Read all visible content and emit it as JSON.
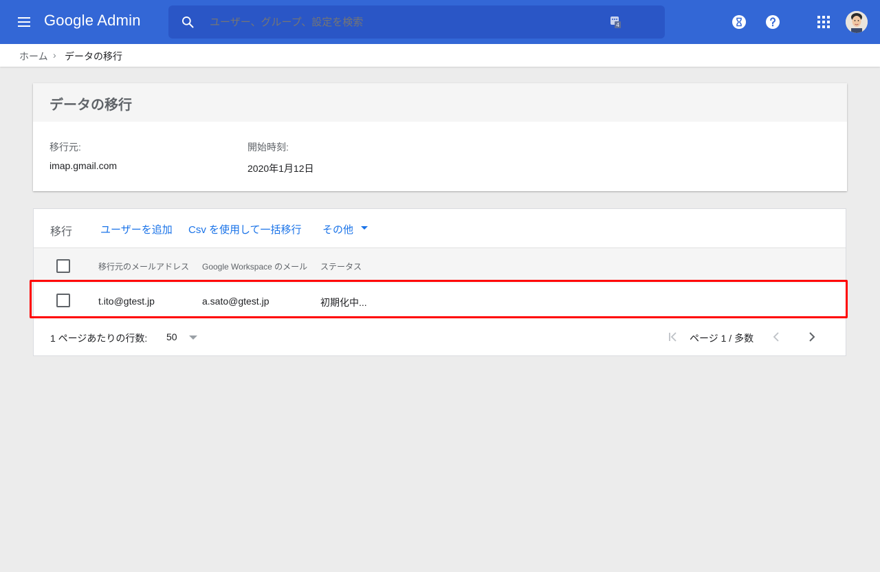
{
  "app": {
    "title_google": "Google",
    "title_admin": "Admin"
  },
  "search": {
    "placeholder": "ユーザー、グループ、設定を検索",
    "badge": "4"
  },
  "topbar_icons": [
    "menu-icon",
    "search-icon",
    "keyboard-shortcut-icon",
    "hourglass-icon",
    "help-icon",
    "apps-icon",
    "avatar"
  ],
  "breadcrumb": {
    "home": "ホーム",
    "separator": "›",
    "current": "データの移行"
  },
  "info_card": {
    "title": "データの移行",
    "source_label": "移行元:",
    "source_value": "imap.gmail.com",
    "start_label": "開始時刻:",
    "start_value": "2020年1月12日"
  },
  "table_card": {
    "toolbar_label": "移行",
    "add_user": "ユーザーを追加",
    "bulk_csv": "Csv を使用して一括移行",
    "more": "その他",
    "columns": [
      "移行元のメールアドレス",
      "Google Workspace のメール",
      "ステータス"
    ],
    "rows": [
      {
        "source_email": "t.ito@gtest.jp",
        "workspace_email": "a.sato@gtest.jp",
        "status": "初期化中..."
      }
    ],
    "rows_per_page_label": "1 ページあたりの行数:",
    "rows_per_page_value": "50",
    "page_info": "ページ 1 / 多数"
  },
  "colors": {
    "topbar": "#3367d6",
    "search_bg": "#2a56c6",
    "link": "#1a73e8",
    "highlight": "#ff0000",
    "page_bg": "#ececec"
  }
}
